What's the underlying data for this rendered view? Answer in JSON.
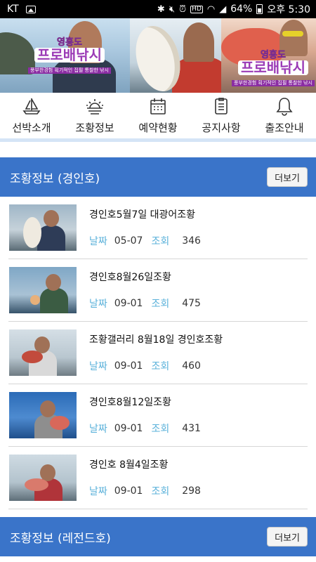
{
  "status_bar": {
    "carrier": "KT",
    "battery": "64%",
    "time": "오후 5:30",
    "icons": [
      "image-icon",
      "bluetooth-icon",
      "mute-icon",
      "alarm-icon",
      "hd-icon",
      "wifi-icon",
      "signal-icon",
      "battery-icon"
    ]
  },
  "banner": {
    "logos": [
      {
        "line1": "영흥도",
        "line2": "프로배낚시",
        "tagline": "풍부한경험 획기적인 집필 통찰한 낚시"
      },
      {
        "line1": "영흥도",
        "line2": "프로배낚시",
        "tagline": "풍부한경험 획기적인 집필 통찰한 낚시"
      }
    ]
  },
  "nav": [
    {
      "label": "선박소개",
      "icon": "sailboat-icon"
    },
    {
      "label": "조황정보",
      "icon": "sunrise-icon"
    },
    {
      "label": "예약현황",
      "icon": "calendar-icon"
    },
    {
      "label": "공지사항",
      "icon": "notice-icon"
    },
    {
      "label": "출조안내",
      "icon": "bell-icon"
    }
  ],
  "sections": [
    {
      "title": "조황정보 (경인호)",
      "more_label": "더보기",
      "items": [
        {
          "title": "경인호5월7일 대광어조황",
          "date_label": "날짜",
          "date": "05-07",
          "views_label": "조회",
          "views": "346"
        },
        {
          "title": "경인호8월26일조황",
          "date_label": "날짜",
          "date": "09-01",
          "views_label": "조회",
          "views": "475"
        },
        {
          "title": "조황갤러리 8월18일 경인호조황",
          "date_label": "날짜",
          "date": "09-01",
          "views_label": "조회",
          "views": "460"
        },
        {
          "title": "경인호8월12일조황",
          "date_label": "날짜",
          "date": "09-01",
          "views_label": "조회",
          "views": "431"
        },
        {
          "title": "경인호 8월4일조황",
          "date_label": "날짜",
          "date": "09-01",
          "views_label": "조회",
          "views": "298"
        }
      ]
    },
    {
      "title": "조황정보 (레전드호)",
      "more_label": "더보기",
      "items": []
    }
  ],
  "colors": {
    "section_header": "#3a74c9",
    "meta_label": "#5ab1da",
    "nav_divider": "#d5e4f6"
  }
}
